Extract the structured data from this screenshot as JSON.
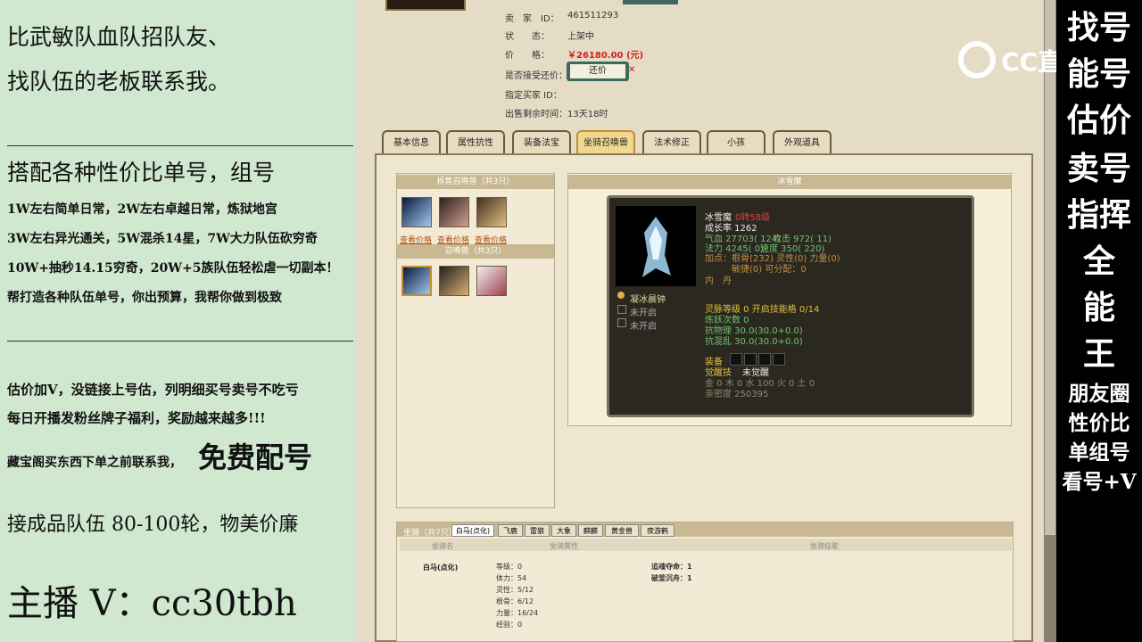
{
  "left_panel": {
    "line1": "比武敏队血队招队友、",
    "line2": "找队伍的老板联系我。",
    "line3": "搭配各种性价比单号，组号",
    "line4": "1W左右简单日常，2W左右卓越日常，炼狱地宫",
    "line5": "3W左右异光通关，5W混杀14星，7W大力队伍砍穷奇",
    "line6": "10W+抽秒14.15穷奇，20W+5族队伍轻松虐一切副本！",
    "line7": "帮打造各种队伍单号，你出预算，我帮你做到极致",
    "line8": "估价加V，没链接上号估，列明细买号卖号不吃亏",
    "line9": "每日开播发粉丝牌子福利，奖励越来越多!!!",
    "line10a": "藏宝阁买东西下单之前联系我，",
    "line10b": "免费配号",
    "line11": "接成品队伍 80-100轮，物美价廉",
    "line12": "主播 V：cc30tbh"
  },
  "right_panel": {
    "chars": [
      "找号",
      "能号",
      "估价",
      "卖号",
      "指挥",
      "全",
      "能",
      "王"
    ],
    "lines": [
      "朋友圈",
      "性价比",
      "单组号",
      "看号+V"
    ]
  },
  "logo": {
    "text": "CC直播"
  },
  "info": {
    "seller_label": "卖　家　ID：",
    "seller_value": "461511293",
    "status_label": "状　　态：",
    "status_value": "上架中",
    "price_label": "价　　格：",
    "price_value": "￥26180.00 (元)",
    "counter_label": "是否接受还价：",
    "counter_button": "还价",
    "buyer_label": "指定买家 ID：",
    "time_label": "出售剩余时间：",
    "time_value": "13天18时"
  },
  "tabs": [
    "基本信息",
    "属性抗性",
    "装备法宝",
    "坐骑召唤兽",
    "法术修正",
    "小孩",
    "外观道具"
  ],
  "left_box": {
    "head1": "拆售召唤兽（共3只）",
    "links": [
      "查看价格",
      "查看价格",
      "查看价格"
    ],
    "head2": "召唤兽（共3只）"
  },
  "detail": {
    "header": "冰雪魔",
    "name": "冰雪魔",
    "rebirth": "0转58级",
    "growth": "成长率 1262",
    "hp": "气血 27703( 124)",
    "attack": "攻击 972( 11)",
    "mana": "法力 4245( 0)",
    "speed": "速度 350( 220)",
    "points": "加点：根骨(232) 灵性(0) 力量(0)",
    "points2": "敏捷(0) 可分配：0",
    "neidan": "内　丹",
    "skill1": "凝冰晨钟",
    "skill2": "未开启",
    "skill3": "未开启",
    "spirit": "灵脉等级 0 开启技能格 0/14",
    "demon": "炼妖次数 0",
    "res1": "抗物理 30.0(30.0+0.0)",
    "res2": "抗混乱 30.0(30.0+0.0)",
    "equip": "装备",
    "awaken": "觉醒技",
    "awaken_value": "未觉醒",
    "elements": "金 0 木 0 水 100 火 0 土 0",
    "intimacy": "亲密度 250395"
  },
  "mount": {
    "head": "坐骑（共7只）",
    "subtabs": [
      "白马(点化)",
      "飞鹿",
      "雷狼",
      "大象",
      "麒麟",
      "黄金兽",
      "夜游鹤"
    ],
    "col1": "坐骑名",
    "col2": "坐骑属性",
    "col3": "坐骑技能",
    "name": "白马(点化)",
    "stats": [
      "等级：0",
      "体力：54",
      "灵性：5/12",
      "根骨：6/12",
      "力量：16/24",
      "经验：0"
    ],
    "skills": [
      "追魂夺命：1",
      "破釜沉舟：1"
    ]
  },
  "colors": {
    "left_bg": "#cfe8cf",
    "game_bg": "#e5dcc5",
    "price_red": "#d02020",
    "detail_bg": "#2b2820"
  }
}
